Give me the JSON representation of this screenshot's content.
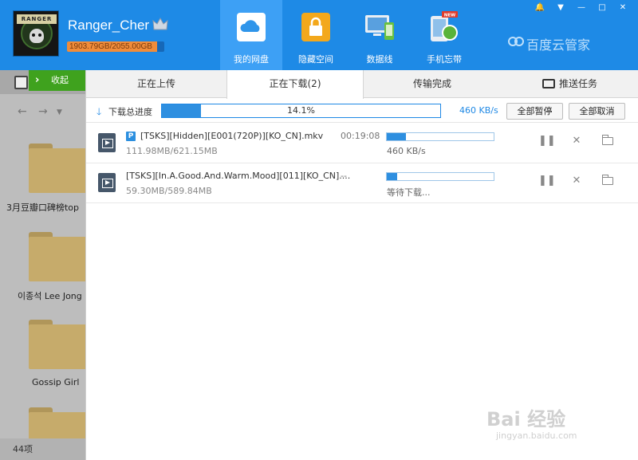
{
  "header": {
    "username": "Ranger_Cher",
    "avatar_text": "RANGER",
    "quota_text": "1903.79GB/2055.00GB",
    "quota_used_fraction": 0.926,
    "nav": [
      {
        "label": "我的网盘",
        "icon": "cloud-icon",
        "active": true
      },
      {
        "label": "隐藏空间",
        "icon": "lock-icon",
        "active": false
      },
      {
        "label": "数据线",
        "icon": "devices-icon",
        "active": false
      },
      {
        "label": "手机忘带",
        "icon": "phone-sync-icon",
        "active": false,
        "badge": "NEW"
      }
    ],
    "brand": "百度云管家",
    "window_buttons": [
      "🔔",
      "▼",
      "—",
      "□",
      "✕"
    ]
  },
  "left_panel": {
    "collapse_label": "收起",
    "folders": [
      {
        "name": "3月豆瓣口碑榜top"
      },
      {
        "name": "이종석 Lee Jong"
      },
      {
        "name": "Gossip Girl"
      },
      {
        "name": ""
      }
    ],
    "status": "44项"
  },
  "tabs": [
    {
      "label": "正在上传",
      "active": false
    },
    {
      "label": "正在下载(2)",
      "active": true
    },
    {
      "label": "传输完成",
      "active": false
    },
    {
      "label": "推送任务",
      "active": false
    }
  ],
  "progress": {
    "label": "下载总进度",
    "percent_text": "14.1%",
    "percent": 14.1,
    "speed": "460 KB/s",
    "pause_all": "全部暂停",
    "cancel_all": "全部取消"
  },
  "downloads": [
    {
      "filename": "[TSKS][Hidden][E001(720P)][KO_CN].mkv",
      "size": "111.98MB/621.15MB",
      "time": "00:19:08",
      "status": "460 KB/s",
      "progress": 0.18,
      "badge": "P"
    },
    {
      "filename": "[TSKS][In.A.Good.And.Warm.Mood][011][KO_CN]....",
      "size": "59.30MB/589.84MB",
      "time": "--",
      "status": "等待下载...",
      "progress": 0.1,
      "badge": ""
    }
  ],
  "watermark": {
    "text": "Bai 经验",
    "url": "jingyan.baidu.com"
  }
}
